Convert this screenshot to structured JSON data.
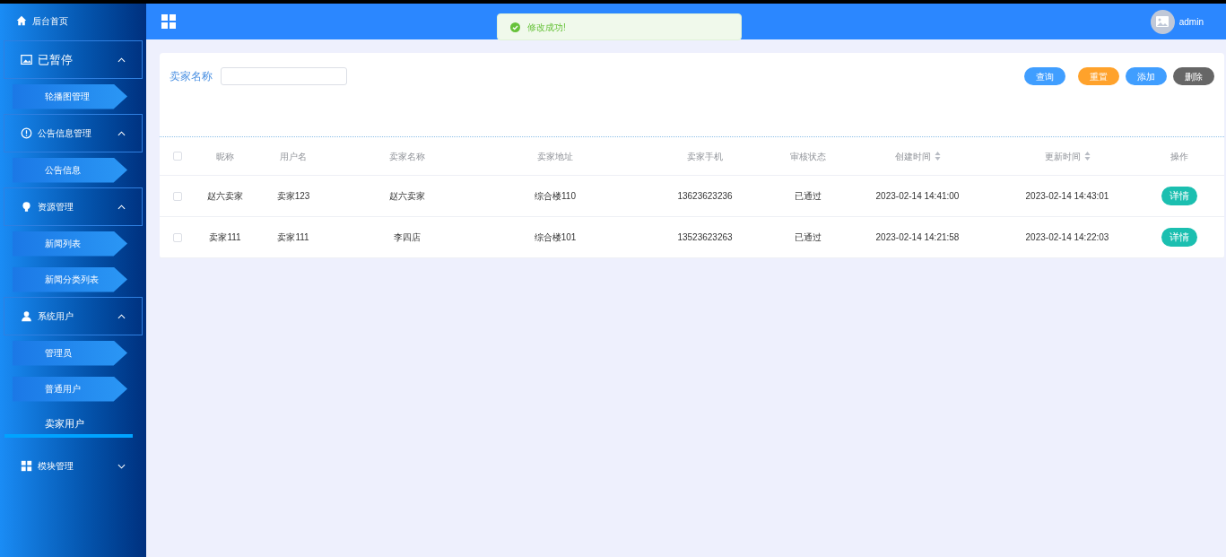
{
  "sidebar": {
    "home": {
      "label": "后台首页"
    },
    "groups": [
      {
        "label": "已暂停",
        "kind": "image",
        "expanded": true,
        "children": [
          {
            "label": "轮播图管理",
            "selected": false
          }
        ]
      },
      {
        "label": "公告信息管理",
        "kind": "info",
        "expanded": true,
        "children": [
          {
            "label": "公告信息",
            "selected": false
          }
        ]
      },
      {
        "label": "资源管理",
        "kind": "bulb",
        "expanded": true,
        "children": [
          {
            "label": "新闻列表",
            "selected": false
          },
          {
            "label": "新闻分类列表",
            "selected": false
          }
        ]
      },
      {
        "label": "系统用户",
        "kind": "user",
        "expanded": true,
        "children": [
          {
            "label": "管理员",
            "selected": false
          },
          {
            "label": "普通用户",
            "selected": false
          },
          {
            "label": "卖家用户",
            "selected": true
          }
        ]
      },
      {
        "label": "模块管理",
        "kind": "grid",
        "expanded": false
      }
    ]
  },
  "header": {
    "user": "admin"
  },
  "toast": {
    "message": "修改成功!"
  },
  "search": {
    "label": "卖家名称"
  },
  "buttons": [
    {
      "label": "查询",
      "kind": "query"
    },
    {
      "label": "重置",
      "kind": "reset"
    },
    {
      "label": "添加",
      "kind": "add"
    },
    {
      "label": "删除",
      "kind": "delete"
    }
  ],
  "table": {
    "all_checked": false,
    "columns": [
      {
        "label": "昵称",
        "sortable": false
      },
      {
        "label": "用户名",
        "sortable": false
      },
      {
        "label": "卖家名称",
        "sortable": false
      },
      {
        "label": "卖家地址",
        "sortable": false
      },
      {
        "label": "卖家手机",
        "sortable": false
      },
      {
        "label": "审核状态",
        "sortable": false
      },
      {
        "label": "创建时间",
        "sortable": true
      },
      {
        "label": "更新时间",
        "sortable": true
      },
      {
        "label": "操作",
        "sortable": false
      }
    ],
    "rows": [
      {
        "checked": false,
        "cells": [
          "赵六卖家",
          "卖家123",
          "赵六卖家",
          "综合楼110",
          "13623623236",
          "已通过",
          "2023-02-14 14:41:00",
          "2023-02-14 14:43:01"
        ],
        "action": "详情"
      },
      {
        "checked": false,
        "cells": [
          "卖家111",
          "卖家111",
          "李四店",
          "综合楼101",
          "13523623263",
          "已通过",
          "2023-02-14 14:21:58",
          "2023-02-14 14:22:03"
        ],
        "action": "详情"
      }
    ]
  }
}
